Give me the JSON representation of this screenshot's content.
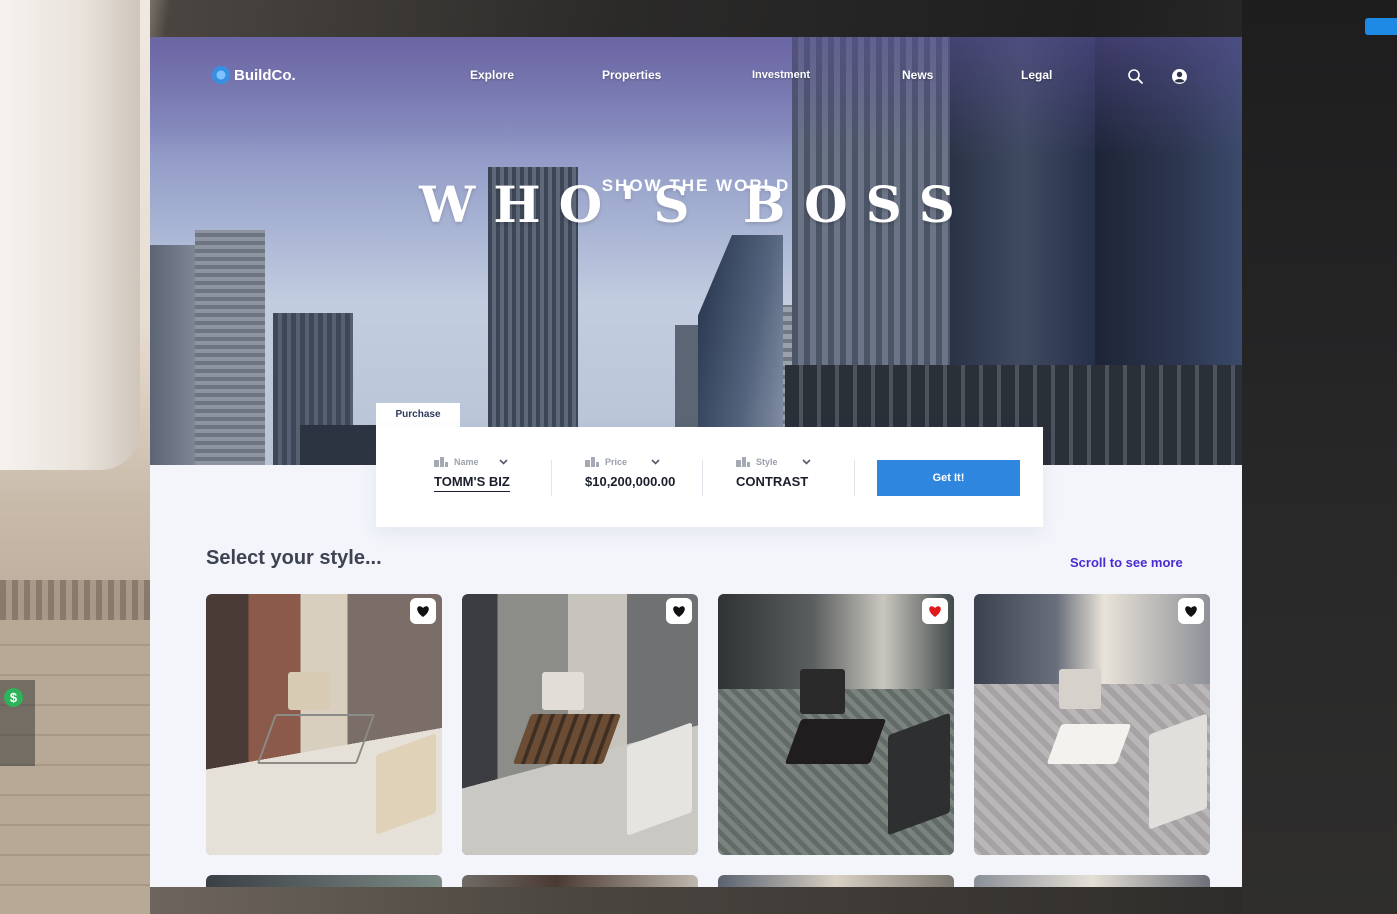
{
  "brand": {
    "name": "BuildCo."
  },
  "nav": {
    "items": [
      "Explore",
      "Properties",
      "Investment",
      "News",
      "Legal"
    ]
  },
  "hero": {
    "kicker": "SHOW THE WORLD",
    "title": "WHO'S BOSS"
  },
  "purchase": {
    "tab_label": "Purchase",
    "fields": [
      {
        "label": "Name",
        "value": "TOMM'S BIZ"
      },
      {
        "label": "Price",
        "value": "$10,200,000.00"
      },
      {
        "label": "Style",
        "value": "CONTRAST"
      }
    ],
    "cta_label": "Get It!"
  },
  "styles": {
    "title": "Select your style...",
    "scroll_hint": "Scroll to see more",
    "cards": [
      {
        "favorite": false
      },
      {
        "favorite": false
      },
      {
        "favorite": true
      },
      {
        "favorite": false
      }
    ]
  },
  "colors": {
    "accent": "#2f86de",
    "link": "#4b2bcf",
    "heart_active": "#e0191f",
    "heart_inactive": "#111111"
  },
  "icons": [
    "search-icon",
    "user-icon",
    "heart-icon",
    "chevron-down-icon",
    "building-icon",
    "money-icon"
  ]
}
